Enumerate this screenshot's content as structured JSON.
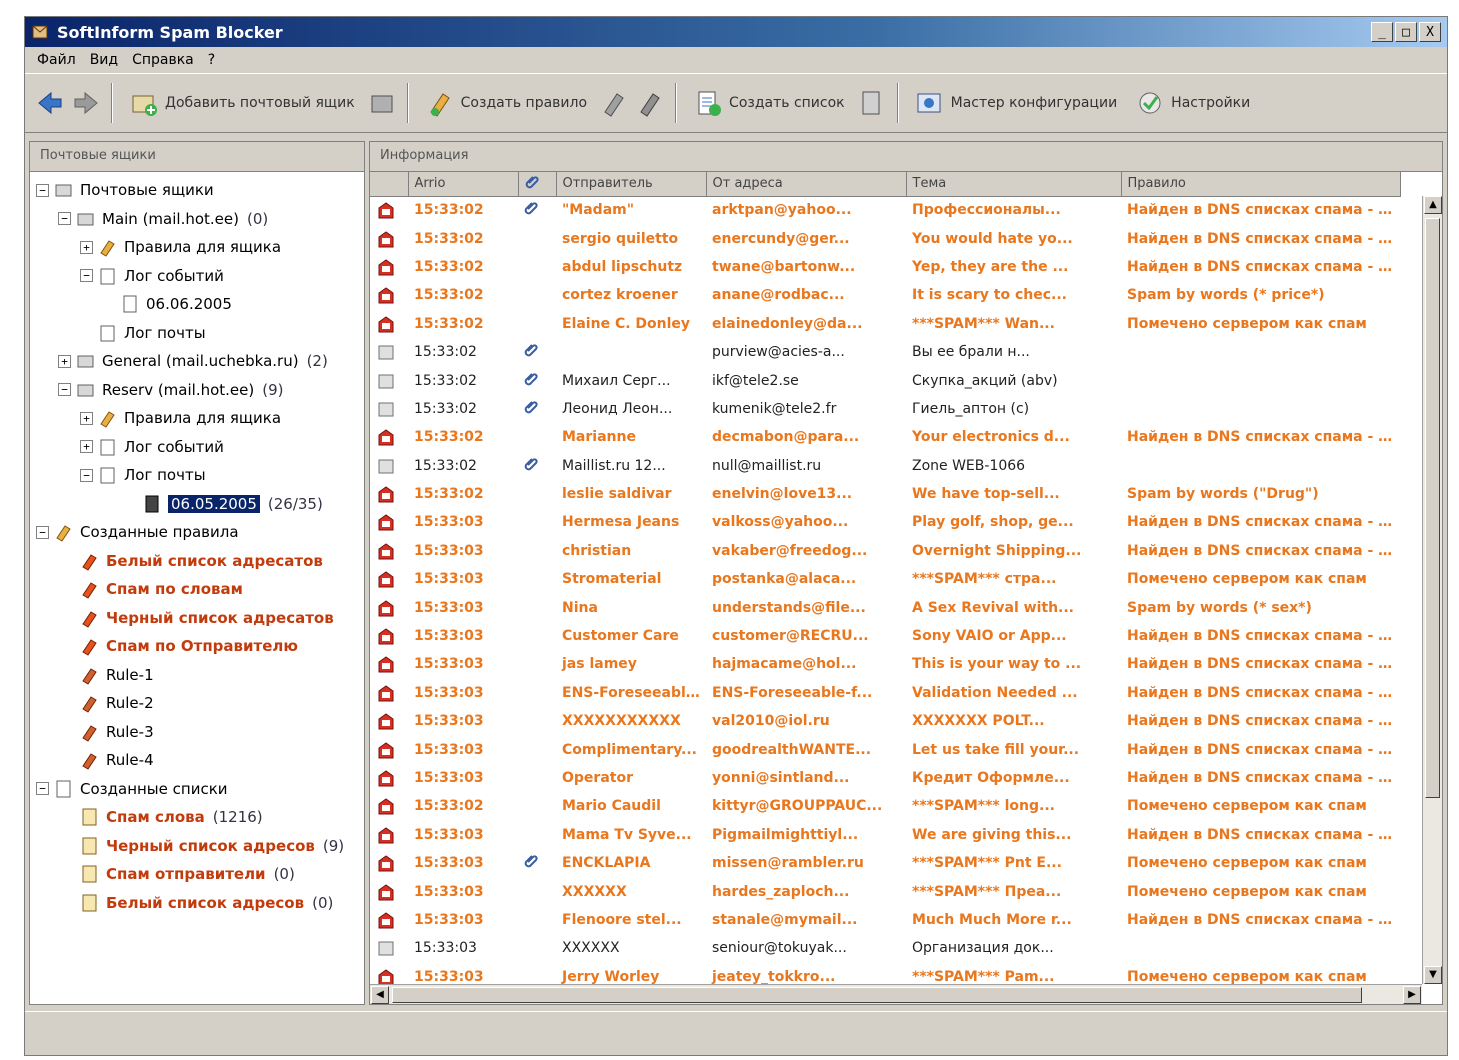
{
  "window": {
    "title": "SoftInform Spam Blocker",
    "controls": [
      "_",
      "□",
      "X"
    ]
  },
  "menu": [
    "Файл",
    "Вид",
    "Справка",
    "?"
  ],
  "toolbar": {
    "add_mailbox": "Добавить почтовый ящик",
    "create_rule": "Создать правило",
    "create_list": "Создать список",
    "wizard": "Мастер конфигурации",
    "settings": "Настройки"
  },
  "left_header": "Почтовые ящики",
  "right_header": "Информация",
  "tree": {
    "mailboxes": "Почтовые ящики",
    "main": {
      "label": "Main (mail.hot.ee)",
      "count": "(0)"
    },
    "main_rules": "Правила для ящика",
    "main_events": "Лог событий",
    "main_date": "06.06.2005",
    "main_maillog": "Лог почты",
    "general": {
      "label": "General (mail.uchebka.ru)",
      "count": "(2)"
    },
    "reserv": {
      "label": "Reserv (mail.hot.ee)",
      "count": "(9)"
    },
    "reserv_rules": "Правила для ящика",
    "reserv_events": "Лог событий",
    "reserv_maillog": "Лог почты",
    "reserv_date": {
      "label": "06.05.2005",
      "count": "(26/35)"
    },
    "created_rules": "Созданные правила",
    "rules": [
      "Белый список адресатов",
      "Спам по словам",
      "Черный список адресатов",
      "Спам по Отправителю",
      "Rule-1",
      "Rule-2",
      "Rule-3",
      "Rule-4"
    ],
    "created_lists": "Созданные списки",
    "lists": [
      {
        "label": "Спам слова",
        "count": "(1216)"
      },
      {
        "label": "Черный список адресов",
        "count": "(9)"
      },
      {
        "label": "Спам отправители",
        "count": "(0)"
      },
      {
        "label": "Белый список адресов",
        "count": "(0)"
      }
    ]
  },
  "table": {
    "columns": [
      "Arrio",
      "Отправитель",
      "От адреса",
      "Тема",
      "Правило"
    ],
    "rows": [
      {
        "spam": true,
        "clip": true,
        "time": "15:33:02",
        "from": "\"Madam\"",
        "addr": "arktpan@yahoo...",
        "subj": "Профессионалы...",
        "rule": "Найден в DNS списках спама - dbl-s..."
      },
      {
        "spam": true,
        "clip": false,
        "time": "15:33:02",
        "from": "sergio quiletto",
        "addr": "enercundy@ger...",
        "subj": "You would hate yo...",
        "rule": "Найден в DNS списках спама - dbl-s..."
      },
      {
        "spam": true,
        "clip": false,
        "time": "15:33:02",
        "from": "abdul lipschutz",
        "addr": "twane@bartonw...",
        "subj": "Yep, they are the ...",
        "rule": "Найден в DNS списках спама - dbl-s..."
      },
      {
        "spam": true,
        "clip": false,
        "time": "15:33:02",
        "from": "cortez kroener",
        "addr": "anane@rodbac...",
        "subj": "It is scary to chec...",
        "rule": "Spam by words (* price*)"
      },
      {
        "spam": true,
        "clip": false,
        "time": "15:33:02",
        "from": "Elaine C. Donley",
        "addr": "elainedonley@da...",
        "subj": "***SPAM*** Wan...",
        "rule": "Помечено сервером как спам"
      },
      {
        "spam": false,
        "clip": true,
        "time": "15:33:02",
        "from": "",
        "addr": "purview@acies-a...",
        "subj": "Вы ее брали н...",
        "rule": ""
      },
      {
        "spam": false,
        "clip": true,
        "time": "15:33:02",
        "from": "Михаил Серг...",
        "addr": "ikf@tele2.se",
        "subj": "Скупка_акций (abv)",
        "rule": ""
      },
      {
        "spam": false,
        "clip": true,
        "time": "15:33:02",
        "from": "Леонид Леон...",
        "addr": "kumenik@tele2.fr",
        "subj": "Гиель_aптон (c)",
        "rule": ""
      },
      {
        "spam": true,
        "clip": false,
        "time": "15:33:02",
        "from": "Marianne",
        "addr": "decmabon@para...",
        "subj": "Your electronics d...",
        "rule": "Найден в DNS списках спама - dbl-s..."
      },
      {
        "spam": false,
        "clip": true,
        "time": "15:33:02",
        "from": "Maillist.ru 12...",
        "addr": "null@maillist.ru",
        "subj": "Zone WEB-1066",
        "rule": ""
      },
      {
        "spam": true,
        "clip": false,
        "time": "15:33:02",
        "from": "leslie saldivar",
        "addr": "enelvin@love13...",
        "subj": "We have top-sell...",
        "rule": "Spam by words (\"Drug\")"
      },
      {
        "spam": true,
        "clip": false,
        "time": "15:33:03",
        "from": "Hermesa Jeans",
        "addr": "valkoss@yahoo...",
        "subj": "Play golf, shop, ge...",
        "rule": "Найден в DNS списках спама - dbl-s..."
      },
      {
        "spam": true,
        "clip": false,
        "time": "15:33:03",
        "from": "christian",
        "addr": "vakaber@freedog...",
        "subj": "Overnight Shipping...",
        "rule": "Найден в DNS списках спама - dbl-s..."
      },
      {
        "spam": true,
        "clip": false,
        "time": "15:33:03",
        "from": "Stromaterial",
        "addr": "postanka@alaca...",
        "subj": "***SPAM*** стра...",
        "rule": "Помечено сервером как спам"
      },
      {
        "spam": true,
        "clip": false,
        "time": "15:33:03",
        "from": "Nina",
        "addr": "understands@file...",
        "subj": "A Sex Revival with...",
        "rule": "Spam by words (* sex*)"
      },
      {
        "spam": true,
        "clip": false,
        "time": "15:33:03",
        "from": "Customer Care",
        "addr": "customer@RECRU...",
        "subj": "Sony VAIO or App...",
        "rule": "Найден в DNS списках спама - dbl-s..."
      },
      {
        "spam": true,
        "clip": false,
        "time": "15:33:03",
        "from": "jas lamey",
        "addr": "hajmacame@hol...",
        "subj": "This is your way to ...",
        "rule": "Найден в DNS списках спама - dbl-s..."
      },
      {
        "spam": true,
        "clip": false,
        "time": "15:33:03",
        "from": "ENS-Foreseeable...",
        "addr": "ENS-Foreseeable-f...",
        "subj": "Validation Needed ...",
        "rule": "Найден в DNS списках спама - dbl-s..."
      },
      {
        "spam": true,
        "clip": false,
        "time": "15:33:03",
        "from": "XXXXXXXXXXX",
        "addr": "val2010@iol.ru",
        "subj": "XXXXXXX POLT...",
        "rule": "Найден в DNS списках спама - dbl-s..."
      },
      {
        "spam": true,
        "clip": false,
        "time": "15:33:03",
        "from": "Complimentary...",
        "addr": "goodrealthWANTE...",
        "subj": "Let us take fill your...",
        "rule": "Найден в DNS списках спама - dbl-s..."
      },
      {
        "spam": true,
        "clip": false,
        "time": "15:33:03",
        "from": "Operator",
        "addr": "yonni@sintland...",
        "subj": "Кредит Оформле...",
        "rule": "Найден в DNS списках спама - dbl-s..."
      },
      {
        "spam": true,
        "clip": false,
        "time": "15:33:02",
        "from": "Mario Caudil",
        "addr": "kittyr@GROUPPAUC...",
        "subj": "***SPAM*** long...",
        "rule": "Помечено сервером как спам"
      },
      {
        "spam": true,
        "clip": false,
        "time": "15:33:03",
        "from": "Mama Tv Syve...",
        "addr": "Pigmailmighttiyl...",
        "subj": "We are giving this...",
        "rule": "Найден в DNS списках спама - dbl-s..."
      },
      {
        "spam": true,
        "clip": true,
        "time": "15:33:03",
        "from": "ENCKLAPIA",
        "addr": "missen@rambler.ru",
        "subj": "***SPAM*** Pnt E...",
        "rule": "Помечено сервером как спам"
      },
      {
        "spam": true,
        "clip": false,
        "time": "15:33:03",
        "from": "XXXXXX",
        "addr": "hardes_zaploch...",
        "subj": "***SPAM*** Преа...",
        "rule": "Помечено сервером как спам"
      },
      {
        "spam": true,
        "clip": false,
        "time": "15:33:03",
        "from": "Flenoore stel...",
        "addr": "stanale@mymail...",
        "subj": "Much Much More r...",
        "rule": "Найден в DNS списках спама - dbl-s..."
      },
      {
        "spam": false,
        "clip": false,
        "time": "15:33:03",
        "from": "XXXXXX",
        "addr": "seniour@tokuyak...",
        "subj": "Организация док...",
        "rule": ""
      },
      {
        "spam": true,
        "clip": false,
        "time": "15:33:03",
        "from": "Jerry Worley",
        "addr": "jeatey_tokkro...",
        "subj": "***SPAM*** Pam...",
        "rule": "Помечено сервером как спам"
      }
    ]
  },
  "colors": {
    "spam": "#e8771e",
    "title_bar": "#0a246a",
    "selection": "#0a246a"
  }
}
